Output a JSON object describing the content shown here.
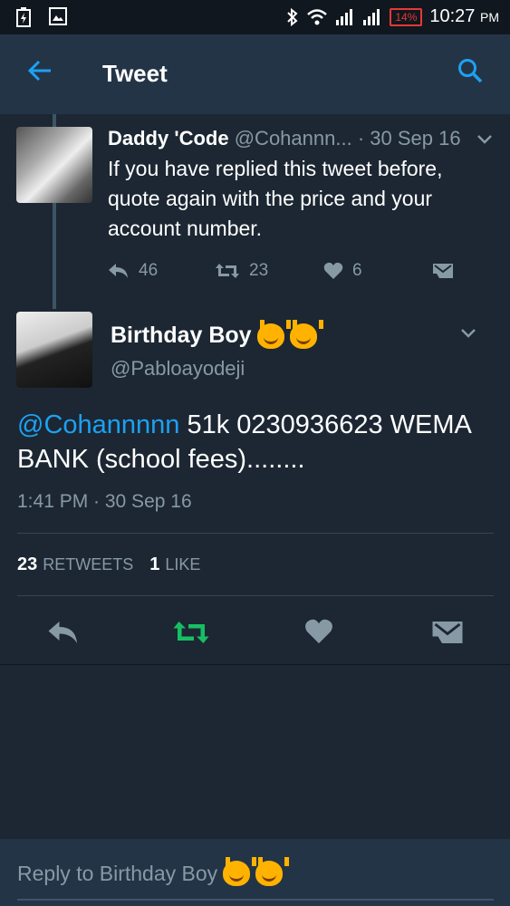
{
  "status_bar": {
    "battery": "14%",
    "time": "10:27",
    "ampm": "PM"
  },
  "header": {
    "title": "Tweet"
  },
  "reply_tweet": {
    "name": "Daddy 'Code",
    "handle": "@Cohannn...",
    "date": "· 30 Sep 16",
    "text": "If you have replied this tweet before, quote again with the price and your account number.",
    "replies": "46",
    "retweets": "23",
    "likes": "6"
  },
  "main_tweet": {
    "name": "Birthday Boy",
    "handle": "@Pabloayodeji",
    "mention": "@Cohannnnn",
    "text": " 51k 0230936623 WEMA BANK (school fees)........",
    "timestamp": "1:41 PM · 30 Sep 16",
    "retweet_count": "23",
    "retweet_label": "RETWEETS",
    "like_count": "1",
    "like_label": "LIKE"
  },
  "reply_box": {
    "placeholder": "Reply to Birthday Boy"
  },
  "colors": {
    "accent": "#1da1f2",
    "retweet_active": "#17bf63",
    "background": "#1c2733",
    "header": "#243447"
  }
}
